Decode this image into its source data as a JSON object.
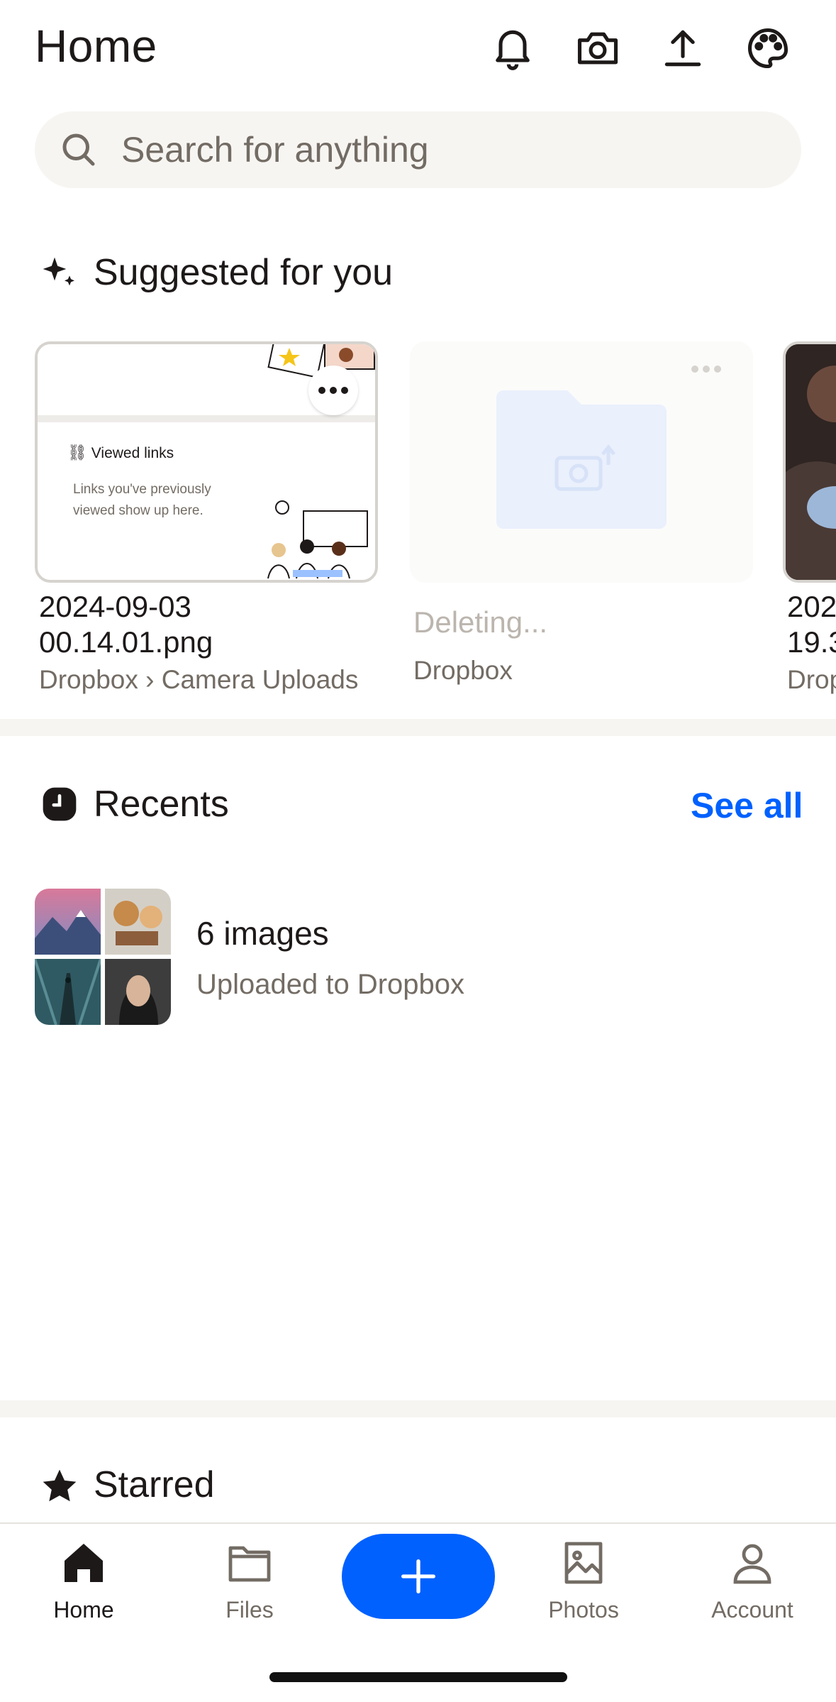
{
  "header": {
    "title": "Home",
    "icons": [
      "bell-icon",
      "camera-icon",
      "upload-icon",
      "palette-icon"
    ]
  },
  "search": {
    "placeholder": "Search for anything",
    "value": ""
  },
  "suggested": {
    "title": "Suggested for you",
    "cards": [
      {
        "preview_title": "Viewed links",
        "preview_text_1": "Links you've previously",
        "preview_text_2": "viewed show up here.",
        "name_line1": "2024-09-03",
        "name_line2": "00.14.01.png",
        "location": "Dropbox › Camera Uploads"
      },
      {
        "status": "Deleting...",
        "location": "Dropbox"
      },
      {
        "name_line1": "202",
        "name_line2": "19.3",
        "location": "Drop"
      }
    ]
  },
  "recents": {
    "title": "Recents",
    "see_all": "See all",
    "items": [
      {
        "title": "6 images",
        "subtitle": "Uploaded to Dropbox"
      }
    ]
  },
  "starred": {
    "title": "Starred"
  },
  "nav": {
    "home": "Home",
    "files": "Files",
    "photos": "Photos",
    "account": "Account"
  },
  "colors": {
    "accent": "#0061fe",
    "text": "#1e1919",
    "muted": "#736c64",
    "surface": "#f7f5f2"
  }
}
